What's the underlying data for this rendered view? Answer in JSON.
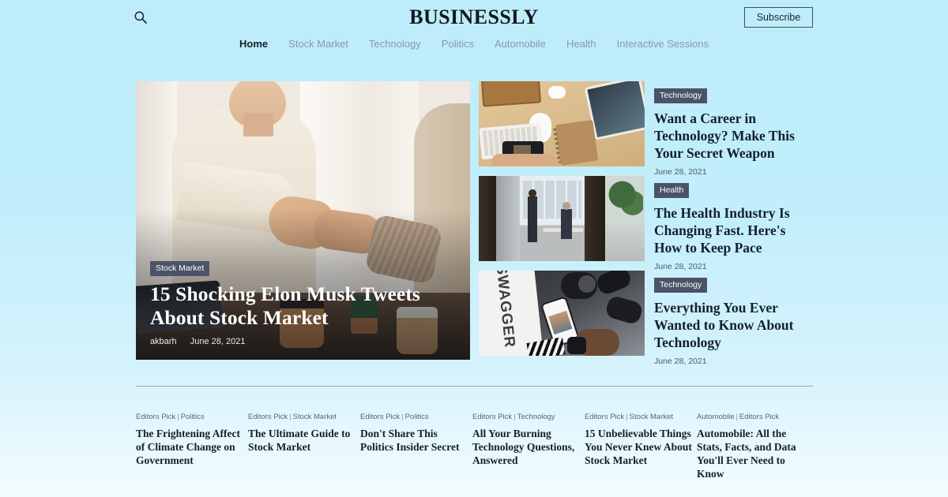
{
  "header": {
    "brand": "BUSINESSLY",
    "search_icon": "search-icon",
    "subscribe_label": "Subscribe"
  },
  "nav": {
    "items": [
      {
        "label": "Home",
        "active": true
      },
      {
        "label": "Stock Market",
        "active": false
      },
      {
        "label": "Technology",
        "active": false
      },
      {
        "label": "Politics",
        "active": false
      },
      {
        "label": "Automobile",
        "active": false
      },
      {
        "label": "Health",
        "active": false
      },
      {
        "label": "Interactive Sessions",
        "active": false
      }
    ]
  },
  "hero": {
    "category": "Stock Market",
    "title": "15 Shocking Elon Musk Tweets About Stock Market",
    "author": "akbarh",
    "date": "June 28, 2021"
  },
  "side_articles": [
    {
      "category": "Technology",
      "title": "Want a Career in Technology? Make This Your Secret Weapon",
      "date": "June 28, 2021"
    },
    {
      "category": "Health",
      "title": "The Health Industry Is Changing Fast. Here's How to Keep Pace",
      "date": "June 28, 2021"
    },
    {
      "category": "Technology",
      "title": "Everything You Ever Wanted to Know About Technology",
      "date": "June 28, 2021"
    }
  ],
  "picks": [
    {
      "cat1": "Editors Pick",
      "cat2": "Politics",
      "title": "The Frightening Affect of Climate Change on Government"
    },
    {
      "cat1": "Editors Pick",
      "cat2": "Stock Market",
      "title": "The Ultimate Guide to Stock Market"
    },
    {
      "cat1": "Editors Pick",
      "cat2": "Politics",
      "title": "Don't Share This Politics Insider Secret"
    },
    {
      "cat1": "Editors Pick",
      "cat2": "Technology",
      "title": "All Your Burning Technology Questions, Answered"
    },
    {
      "cat1": "Editors Pick",
      "cat2": "Stock Market",
      "title": "15 Unbelievable Things You Never Knew About Stock Market"
    },
    {
      "cat1": "Automobile",
      "cat2": "Editors Pick",
      "title": "Automobile: All the Stats, Facts, and Data You'll Ever Need to Know"
    }
  ],
  "colors": {
    "background_top": "#bdecfa",
    "background_bottom": "#f4fcfe",
    "badge_bg": "#4a5368",
    "text_dark": "#13202c",
    "text_muted": "#8c99a5"
  }
}
